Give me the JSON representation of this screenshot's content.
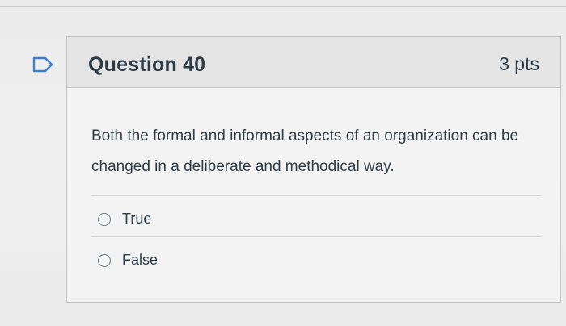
{
  "question": {
    "title": "Question 40",
    "points": "3 pts",
    "text": "Both the formal and informal aspects of an organization can be changed in a deliberate and methodical way.",
    "answers": [
      {
        "label": "True",
        "selected": false
      },
      {
        "label": "False",
        "selected": false
      }
    ]
  },
  "icons": {
    "flag": "flag-question-icon"
  },
  "colors": {
    "text": "#2d3b45",
    "flag": "#3b7fd4",
    "header_bg": "#e4e4e4"
  }
}
